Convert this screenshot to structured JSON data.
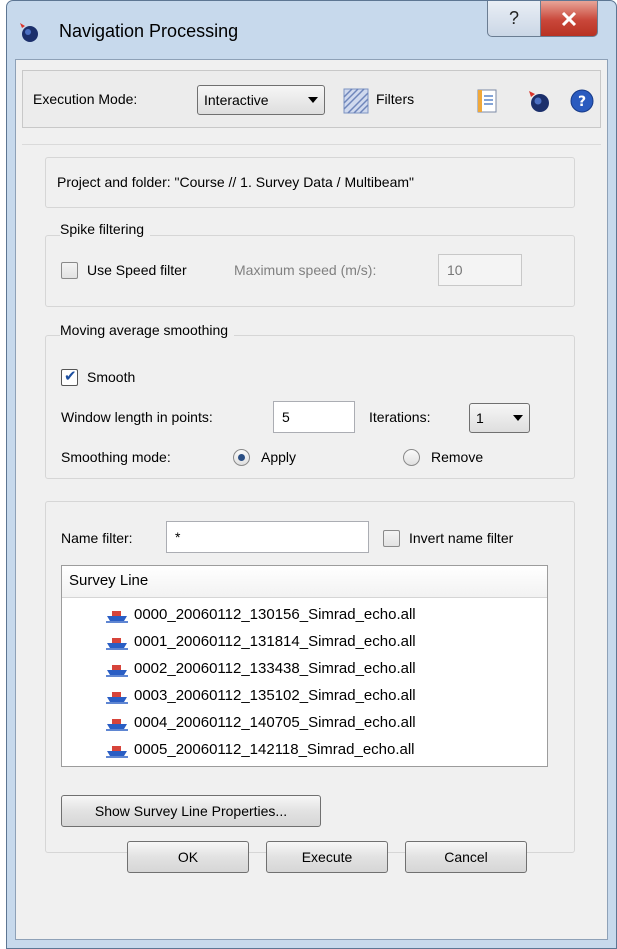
{
  "window": {
    "title": "Navigation Processing",
    "help_button": "?",
    "close_button": "X"
  },
  "toolbar": {
    "execution_mode_label": "Execution Mode:",
    "execution_mode_value": "Interactive",
    "filters_label": "Filters",
    "icons": [
      "filters-icon",
      "notes-icon",
      "app-icon",
      "help-icon"
    ]
  },
  "project": {
    "text": "Project and folder: \"Course // 1. Survey Data / Multibeam\""
  },
  "spike_filtering": {
    "legend": "Spike filtering",
    "use_speed_filter_label": "Use Speed filter",
    "use_speed_filter_checked": false,
    "max_speed_label": "Maximum speed (m/s):",
    "max_speed_value": "10"
  },
  "smoothing": {
    "legend": "Moving average smoothing",
    "smooth_label": "Smooth",
    "smooth_checked": true,
    "window_length_label": "Window length in points:",
    "window_length_value": "5",
    "iterations_label": "Iterations:",
    "iterations_value": "1",
    "mode_label": "Smoothing mode:",
    "apply_label": "Apply",
    "remove_label": "Remove",
    "selected_mode": "Apply"
  },
  "survey": {
    "name_filter_label": "Name filter:",
    "name_filter_value": "*",
    "invert_label": "Invert name filter",
    "invert_checked": false,
    "column_header": "Survey Line",
    "lines": [
      "0000_20060112_130156_Simrad_echo.all",
      "0001_20060112_131814_Simrad_echo.all",
      "0002_20060112_133438_Simrad_echo.all",
      "0003_20060112_135102_Simrad_echo.all",
      "0004_20060112_140705_Simrad_echo.all",
      "0005_20060112_142118_Simrad_echo.all"
    ],
    "properties_button": "Show Survey Line Properties..."
  },
  "buttons": {
    "ok": "OK",
    "execute": "Execute",
    "cancel": "Cancel"
  },
  "colors": {
    "frame": "#c7d9ec",
    "close_button": "#c9473a",
    "dialog_background": "#f0f0f0"
  }
}
